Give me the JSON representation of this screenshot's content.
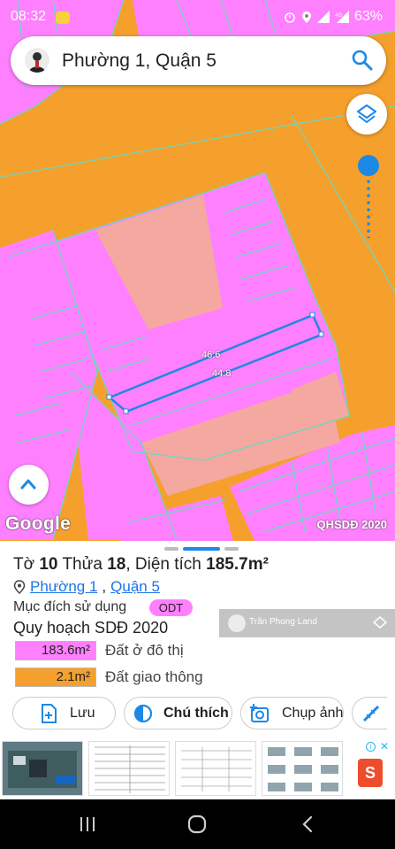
{
  "status_bar": {
    "time": "08:32",
    "battery": "63%"
  },
  "search": {
    "title": "Phường 1, Quận 5"
  },
  "map": {
    "dimension_top": "46.6",
    "dimension_bottom": "44.8",
    "google_logo": "Google",
    "layer_label": "QHSDĐ 2020",
    "colors": {
      "residential": "#ff80ff",
      "transport": "#f5a02c",
      "salmon": "#f4a8a0",
      "outline": "#1e88e5"
    }
  },
  "sheet": {
    "to_label": "Tờ",
    "to_value": "10",
    "thua_label": "Thửa",
    "thua_value": "18",
    "area_label": "Diện tích",
    "area_value": "185.7m²",
    "ward": "Phường 1",
    "separator": ",",
    "district": "Quận 5",
    "purpose_label": "Mục đích sử dụng",
    "purpose_code": "ODT",
    "plan_title": "Quy hoạch SDĐ 2020",
    "legend": [
      {
        "value": "183.6m²",
        "desc": "Đất ở đô thị",
        "color": "#ff80ff"
      },
      {
        "value": "2.1m²",
        "desc": "Đất giao thông",
        "color": "#f5a02c"
      }
    ],
    "watermark": "Trần Phong Land",
    "actions": {
      "save": "Lưu",
      "legend": "Chú thích",
      "photo": "Chụp ảnh"
    }
  },
  "ad": {
    "brand": "S"
  }
}
